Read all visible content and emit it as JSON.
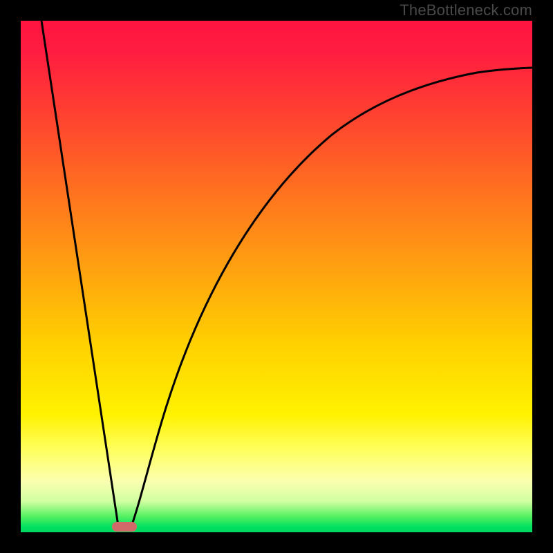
{
  "watermark": "TheBottleneck.com",
  "chart_data": {
    "type": "line",
    "title": "",
    "xlabel": "",
    "ylabel": "",
    "xlim": [
      0,
      100
    ],
    "ylim": [
      0,
      100
    ],
    "gradient_stops": [
      {
        "pos": 0,
        "color": "#ff1440"
      },
      {
        "pos": 18,
        "color": "#ff4030"
      },
      {
        "pos": 48,
        "color": "#ffa010"
      },
      {
        "pos": 77,
        "color": "#fff200"
      },
      {
        "pos": 94,
        "color": "#d0ffa0"
      },
      {
        "pos": 100,
        "color": "#00d860"
      }
    ],
    "series": [
      {
        "name": "left-segment",
        "x": [
          4,
          19
        ],
        "y": [
          100,
          0
        ]
      },
      {
        "name": "right-curve",
        "x": [
          21,
          24,
          28,
          32,
          37,
          43,
          50,
          58,
          68,
          80,
          100
        ],
        "y": [
          0,
          10,
          22,
          33,
          44,
          54,
          63,
          71,
          78,
          84,
          90
        ]
      }
    ],
    "marker": {
      "x": 20,
      "y": 0,
      "label": ""
    }
  }
}
